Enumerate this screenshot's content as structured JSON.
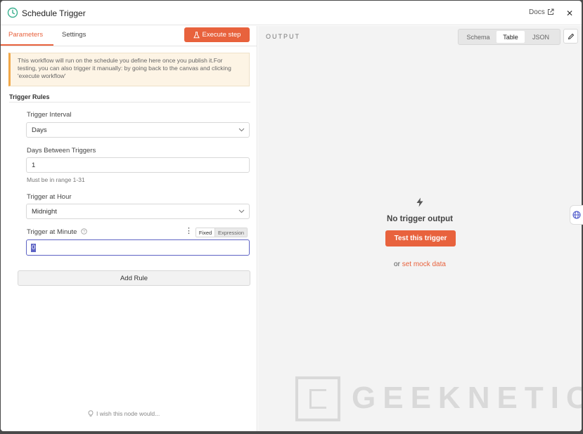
{
  "header": {
    "title": "Schedule Trigger",
    "docs_label": "Docs",
    "close_label": "✕"
  },
  "parameters_panel": {
    "tabs": [
      {
        "label": "Parameters",
        "active": true
      },
      {
        "label": "Settings",
        "active": false
      }
    ],
    "execute_label": "Execute step",
    "notice": "This workflow will run on the schedule you define here once you publish it.For testing, you can also trigger it manually: by going back to the canvas and clicking 'execute workflow'",
    "trigger_rules_heading": "Trigger Rules",
    "fields": {
      "interval": {
        "label": "Trigger Interval",
        "value": "Days"
      },
      "days_between": {
        "label": "Days Between Triggers",
        "value": "1",
        "hint": "Must be in range 1-31"
      },
      "hour": {
        "label": "Trigger at Hour",
        "value": "Midnight"
      },
      "minute": {
        "label": "Trigger at Minute",
        "value": "0",
        "mode_fixed": "Fixed",
        "mode_expression": "Expression"
      }
    },
    "add_rule_label": "Add Rule",
    "wish_label": "I wish this node would..."
  },
  "output_panel": {
    "label": "OUTPUT",
    "views": [
      {
        "label": "Schema",
        "active": false
      },
      {
        "label": "Table",
        "active": true
      },
      {
        "label": "JSON",
        "active": false
      }
    ],
    "empty_title": "No trigger output",
    "test_label": "Test this trigger",
    "mock_prefix": "or",
    "mock_link": "set mock data"
  },
  "watermark": {
    "text": "GEEKNETIC"
  },
  "colors": {
    "accent": "#e8623d",
    "focus": "#5d63c4",
    "notice_bg": "#fdf4e5",
    "clock_icon": "#3bb08f"
  }
}
